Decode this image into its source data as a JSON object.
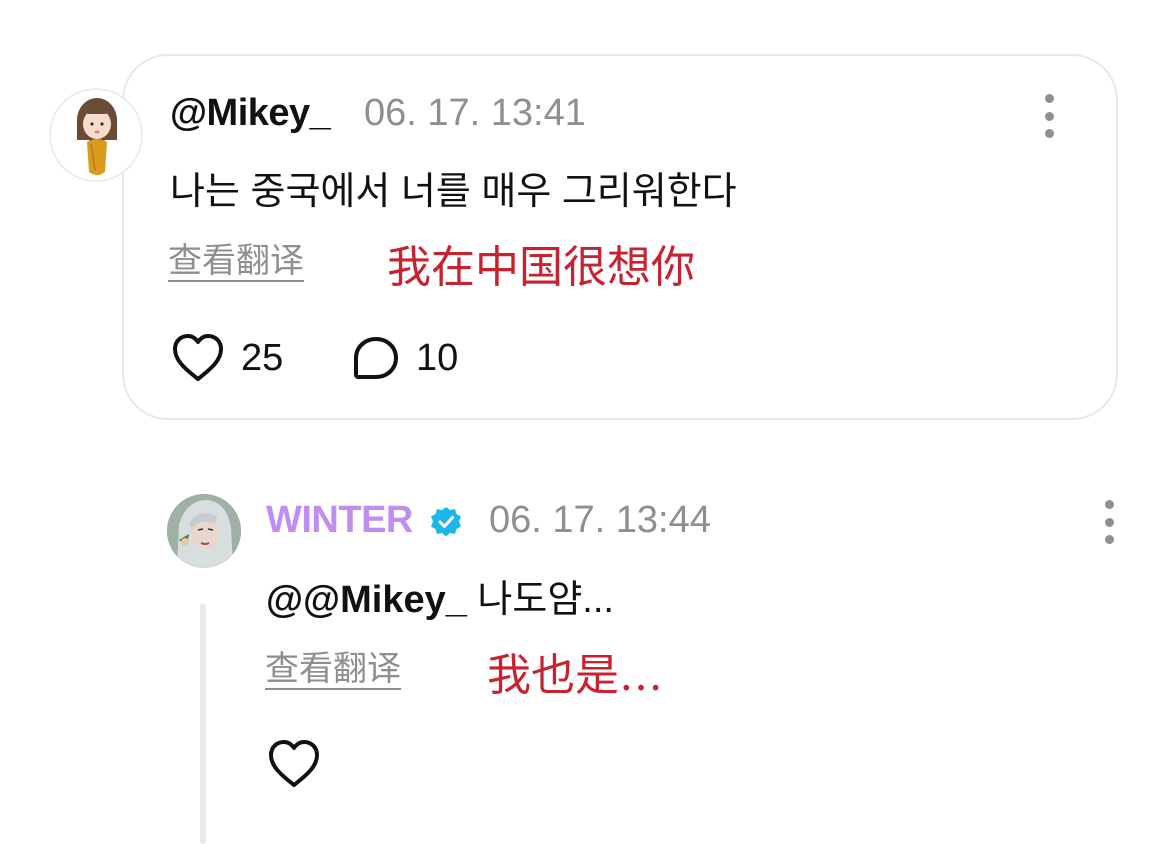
{
  "comment": {
    "username": "@Mikey_",
    "timestamp": "06. 17. 13:41",
    "text": "나는 중국에서 너를 매우 그리워한다",
    "translate_label": "查看翻译",
    "translation": "我在中国很想你",
    "likes": "25",
    "replies": "10"
  },
  "reply": {
    "username": "WINTER",
    "verified": true,
    "username_color": "#c08ef0",
    "timestamp": "06. 17. 13:44",
    "mention": "@@Mikey_",
    "text": "나도얌...",
    "translate_label": "查看翻译",
    "translation": "我也是…"
  },
  "colors": {
    "translation_red": "#c8212f",
    "meta_gray": "#8e8e93",
    "verified_badge": "#1fb6e8"
  }
}
